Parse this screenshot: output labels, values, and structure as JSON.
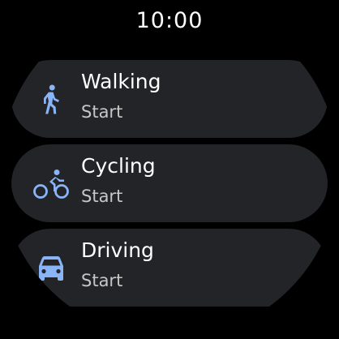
{
  "status_bar": {
    "time": "10:00"
  },
  "accent_color": "#8ab4f8",
  "activities": [
    {
      "title": "Walking",
      "subtitle": "Start",
      "icon": "walking-icon"
    },
    {
      "title": "Cycling",
      "subtitle": "Start",
      "icon": "cycling-icon"
    },
    {
      "title": "Driving",
      "subtitle": "Start",
      "icon": "car-icon"
    }
  ]
}
